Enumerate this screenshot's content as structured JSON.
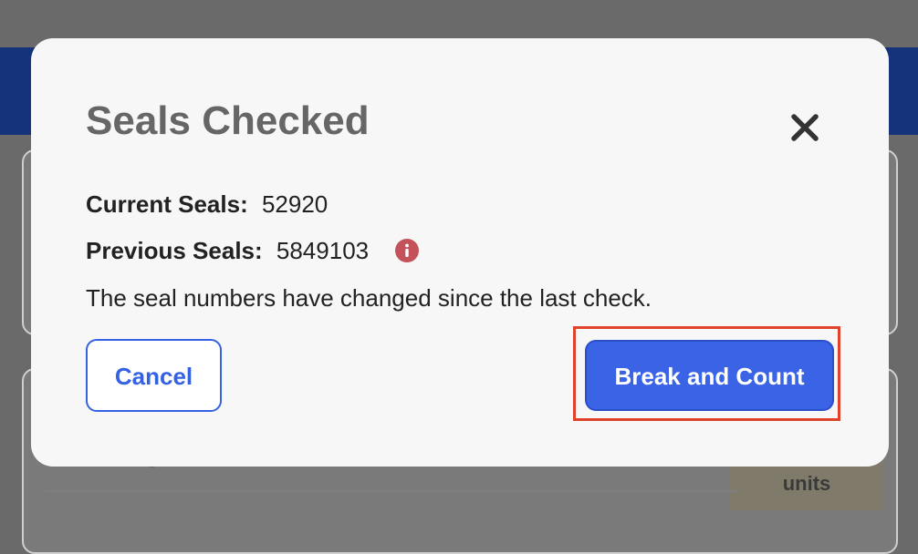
{
  "background": {
    "units_label": "units",
    "fragment_text": "g"
  },
  "modal": {
    "title": "Seals Checked",
    "close_icon": "close-icon",
    "current_seals_label": "Current Seals:",
    "current_seals_value": "52920",
    "previous_seals_label": "Previous Seals:",
    "previous_seals_value": "5849103",
    "info_icon": "info-icon",
    "info_icon_color": "#c4525a",
    "message": "The seal numbers have changed since the last check.",
    "cancel_label": "Cancel",
    "primary_label": "Break and Count",
    "accent_color": "#3a63e6",
    "highlight_color": "#e0432b"
  }
}
